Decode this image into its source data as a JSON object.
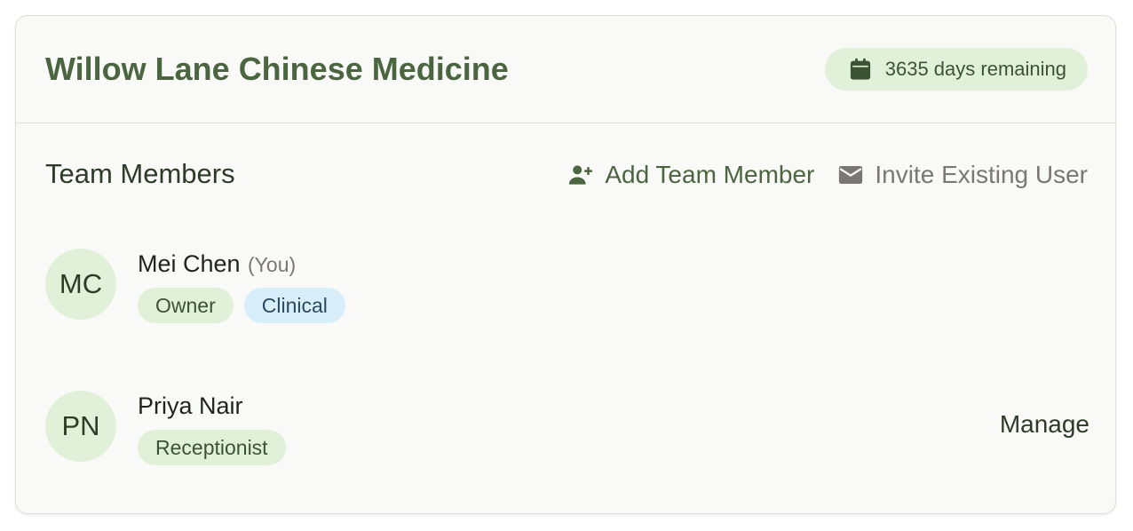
{
  "clinic": {
    "title": "Willow Lane Chinese Medicine",
    "days_remaining": "3635 days remaining",
    "badge_icon": "calendar-icon"
  },
  "team": {
    "section_title": "Team Members",
    "actions": {
      "add_label": "Add Team Member",
      "add_icon": "person-add-icon",
      "invite_label": "Invite Existing User",
      "invite_icon": "envelope-icon"
    },
    "members": [
      {
        "initials": "MC",
        "name": "Mei Chen",
        "you_label": "(You)",
        "roles": [
          "Owner",
          "Clinical"
        ]
      },
      {
        "initials": "PN",
        "name": "Priya Nair",
        "roles": [
          "Receptionist"
        ],
        "manage_label": "Manage"
      }
    ]
  },
  "colors": {
    "brand_green": "#4a6540",
    "badge_green_bg": "#e1f0d9",
    "badge_blue_bg": "#d8eefa",
    "muted_text": "#7a7774"
  }
}
